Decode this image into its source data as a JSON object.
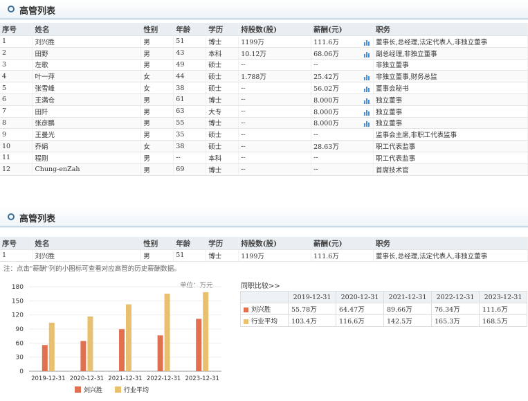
{
  "top": {
    "title": "高管列表",
    "headers": [
      "序号",
      "姓名",
      "性别",
      "年龄",
      "学历",
      "持股数(股)",
      "薪酬(元)",
      "职务"
    ],
    "rows": [
      [
        "1",
        "刘兴胜",
        "男",
        "51",
        "博士",
        "1199万",
        "111.6万",
        "董事长,总经理,法定代表人,非独立董事"
      ],
      [
        "2",
        "田野",
        "男",
        "43",
        "本科",
        "10.12万",
        "68.06万",
        "副总经理,非独立董事"
      ],
      [
        "3",
        "左歌",
        "男",
        "49",
        "硕士",
        "--",
        "--",
        "非独立董事"
      ],
      [
        "4",
        "叶一萍",
        "女",
        "44",
        "硕士",
        "1.788万",
        "25.42万",
        "非独立董事,财务总监"
      ],
      [
        "5",
        "张雪峰",
        "女",
        "38",
        "硕士",
        "--",
        "56.02万",
        "董事会秘书"
      ],
      [
        "6",
        "王满仓",
        "男",
        "61",
        "博士",
        "--",
        "8.000万",
        "独立董事"
      ],
      [
        "7",
        "田阡",
        "男",
        "63",
        "大专",
        "--",
        "8.000万",
        "独立董事"
      ],
      [
        "8",
        "张彦鹏",
        "男",
        "55",
        "博士",
        "--",
        "8.000万",
        "独立董事"
      ],
      [
        "9",
        "王曼光",
        "男",
        "35",
        "硕士",
        "--",
        "--",
        "监事会主席,非职工代表监事"
      ],
      [
        "10",
        "乔娟",
        "女",
        "38",
        "硕士",
        "--",
        "28.63万",
        "职工代表监事"
      ],
      [
        "11",
        "程刚",
        "男",
        "--",
        "本科",
        "--",
        "--",
        "职工代表监事"
      ],
      [
        "12",
        "Chung-enZah",
        "男",
        "69",
        "博士",
        "--",
        "--",
        "首席技术官"
      ]
    ],
    "salary_icon_rows": [
      0,
      1,
      3,
      4,
      5,
      6,
      7
    ]
  },
  "bottom": {
    "title": "高管列表",
    "headers": [
      "序号",
      "姓名",
      "性别",
      "年龄",
      "学历",
      "持股数(股)",
      "薪酬(元)",
      "职务"
    ],
    "row": [
      "1",
      "刘兴胜",
      "男",
      "51",
      "博士",
      "1199万",
      "111.6万",
      "董事长,总经理,法定代表人,非独立董事"
    ],
    "note": "注：点击\"薪酬\"列的小图标可查看对应高管的历史薪酬数据。",
    "unit": "单位：万元",
    "compare_title": "同职比较>>",
    "compare_headers": [
      "2019-12-31",
      "2020-12-31",
      "2021-12-31",
      "2022-12-31",
      "2023-12-31"
    ],
    "compare_rows": [
      {
        "name": "刘兴胜",
        "values": [
          "55.78万",
          "64.47万",
          "89.66万",
          "76.34万",
          "111.6万"
        ]
      },
      {
        "name": "行业平均",
        "values": [
          "103.4万",
          "116.6万",
          "142.5万",
          "165.3万",
          "168.5万"
        ]
      }
    ]
  },
  "chart_data": {
    "type": "bar",
    "categories": [
      "2019-12-31",
      "2020-12-31",
      "2021-12-31",
      "2022-12-31",
      "2023-12-31"
    ],
    "series": [
      {
        "name": "刘兴胜",
        "values": [
          55.78,
          64.47,
          89.66,
          76.34,
          111.6
        ],
        "color": "#e07050"
      },
      {
        "name": "行业平均",
        "values": [
          103.4,
          116.6,
          142.5,
          165.3,
          168.5
        ],
        "color": "#e8c070"
      }
    ],
    "yticks": [
      "180",
      "150",
      "120",
      "90",
      "60",
      "30",
      "0"
    ],
    "ylim": [
      0,
      180
    ],
    "legend": "bottom"
  }
}
